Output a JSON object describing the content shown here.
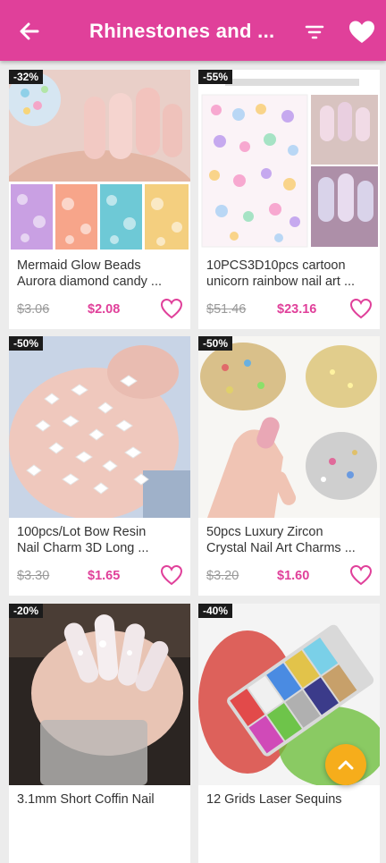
{
  "appbar": {
    "title": "Rhinestones and ...",
    "back_icon": "arrow-left-icon",
    "filter_icon": "filter-icon",
    "favorites_icon": "heart-icon"
  },
  "colors": {
    "accent": "#e0409a",
    "badge": "#1b1b1b",
    "fab": "#f6ad1b"
  },
  "products": [
    {
      "badge": "-32%",
      "name1": "Mermaid Glow Beads",
      "name2": "Aurora diamond candy ...",
      "old_price": "$3.06",
      "new_price": "$2.08"
    },
    {
      "badge": "-55%",
      "name1": "10PCS3D10pcs cartoon",
      "name2": "unicorn rainbow nail art ...",
      "old_price": "$51.46",
      "new_price": "$23.16"
    },
    {
      "badge": "-50%",
      "name1": "100pcs/Lot Bow Resin",
      "name2": "Nail Charm 3D Long ...",
      "old_price": "$3.30",
      "new_price": "$1.65"
    },
    {
      "badge": "-50%",
      "name1": "50pcs Luxury Zircon",
      "name2": "Crystal Nail Art Charms ...",
      "old_price": "$3.20",
      "new_price": "$1.60"
    },
    {
      "badge": "-20%",
      "name1": "3.1mm Short Coffin Nail",
      "name2": "",
      "old_price": "",
      "new_price": ""
    },
    {
      "badge": "-40%",
      "name1": "12 Grids Laser Sequins",
      "name2": "",
      "old_price": "",
      "new_price": ""
    }
  ],
  "fab_icon": "chevron-up-icon"
}
